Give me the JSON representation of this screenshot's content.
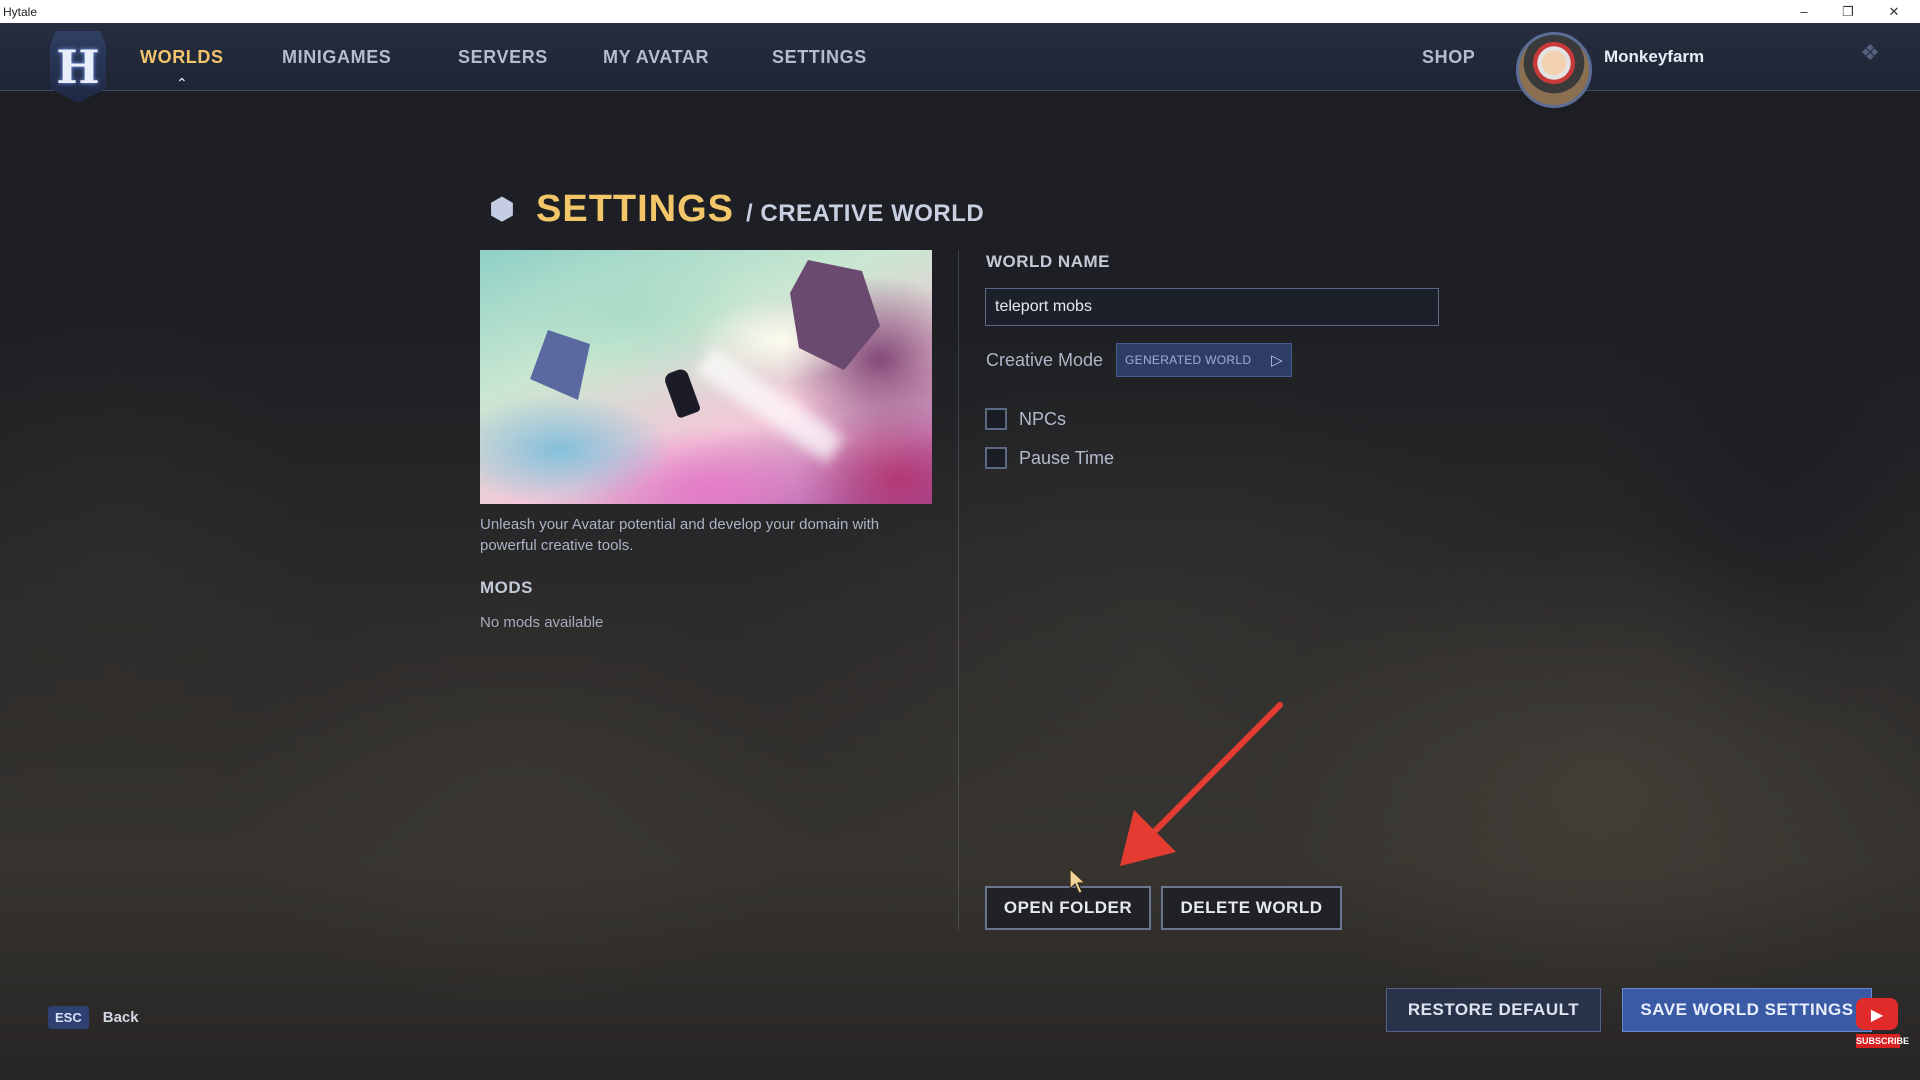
{
  "window": {
    "title": "Hytale",
    "controls": [
      "–",
      "❐",
      "✕"
    ]
  },
  "nav": {
    "logo_letter": "H",
    "items": [
      "WORLDS",
      "MINIGAMES",
      "SERVERS",
      "MY AVATAR",
      "SETTINGS"
    ],
    "active": "WORLDS",
    "shop": "SHOP",
    "username": "Monkeyfarm"
  },
  "page": {
    "title": "SETTINGS",
    "subtitle": "/ CREATIVE WORLD"
  },
  "left": {
    "description": "Unleash your Avatar potential and develop your domain with powerful creative tools.",
    "mods_heading": "MODS",
    "mods_empty": "No mods available"
  },
  "form": {
    "world_name_label": "WORLD NAME",
    "world_name_value": "teleport mobs",
    "mode_label": "Creative Mode",
    "mode_value": "GENERATED WORLD",
    "checkboxes": [
      {
        "label": "NPCs",
        "checked": false
      },
      {
        "label": "Pause Time",
        "checked": false
      }
    ],
    "open_folder": "OPEN FOLDER",
    "delete_world": "DELETE WORLD"
  },
  "footer": {
    "esc_key": "ESC",
    "back_label": "Back",
    "restore_default": "RESTORE DEFAULT",
    "save": "SAVE WORLD SETTINGS"
  },
  "overlay": {
    "subscribe_label": "SUBSCRIBE"
  },
  "colors": {
    "accent_gold": "#f4c66a",
    "primary_button": "#3a5aa6",
    "annotation_arrow": "#e43b32"
  }
}
